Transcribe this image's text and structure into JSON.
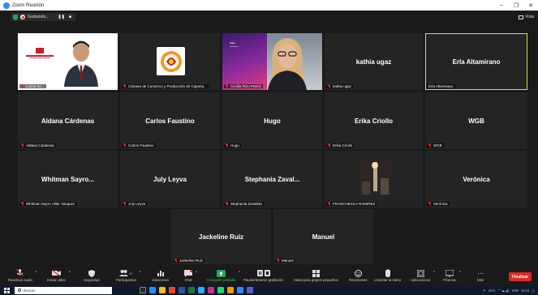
{
  "window": {
    "title": "Zoom Reunión"
  },
  "recording": {
    "label": "Grabando..."
  },
  "view": {
    "label": "Vista"
  },
  "tiles": [
    {
      "label": "Lucho Sc..."
    },
    {
      "label": "Cámara de Comercio y Producción de Cajama..."
    },
    {
      "label": "Cecilia Rizo Patrón"
    },
    {
      "name": "kathia ugaz",
      "label": "kathia ugaz"
    },
    {
      "name": "Erla Altamirano",
      "label": "Erla Altamirano"
    },
    {
      "name": "Aldana Cárdenas",
      "label": "Aldana Cárdenas"
    },
    {
      "name": "Carlos Faustino",
      "label": "Carlos Faustino"
    },
    {
      "name": "Hugo",
      "label": "Hugo"
    },
    {
      "name": "Erika Criollo",
      "label": "Erika Criollo"
    },
    {
      "name": "WGB",
      "label": "WGB"
    },
    {
      "name": "Whitman  Sayro...",
      "label": "Whitman Sayro Villar Vasquez"
    },
    {
      "name": "July Leyva",
      "label": "July Leyva"
    },
    {
      "name": "Stephania  Zaval...",
      "label": "Stephania Zavaleta"
    },
    {
      "label": "FRANCHESCA RAMIREZ"
    },
    {
      "name": "Verónica",
      "label": "Verónica"
    },
    {
      "name": "Jackeline Ruiz",
      "label": "Jackeline Ruiz"
    },
    {
      "name": "Manuel",
      "label": "Manuel"
    }
  ],
  "toolbar": {
    "unmute": "Reactivar audio",
    "start_video": "Iniciar video",
    "security": "Seguridad",
    "participants": "Participantes",
    "participants_count": "17",
    "polls": "Votaciones",
    "chat": "Chat",
    "share": "Compartir pantalla",
    "pause_recording": "Pausar/detener grabación",
    "breakout": "Salas para grupos pequeños",
    "reactions": "Reacciones",
    "raise_hand": "Levantar la mano",
    "apps": "Aplicaciones",
    "whiteboards": "Pizarras",
    "more": "Más",
    "end": "Finalizar"
  },
  "taskbar": {
    "search_placeholder": "Buscar",
    "weather": "24°C",
    "lang": "ESP",
    "time": "19:13"
  },
  "colors": {
    "active_speaker": "#cce84b",
    "end_button": "#e02828",
    "share_green": "#23a35a",
    "zoom_blue": "#2d8cff"
  }
}
